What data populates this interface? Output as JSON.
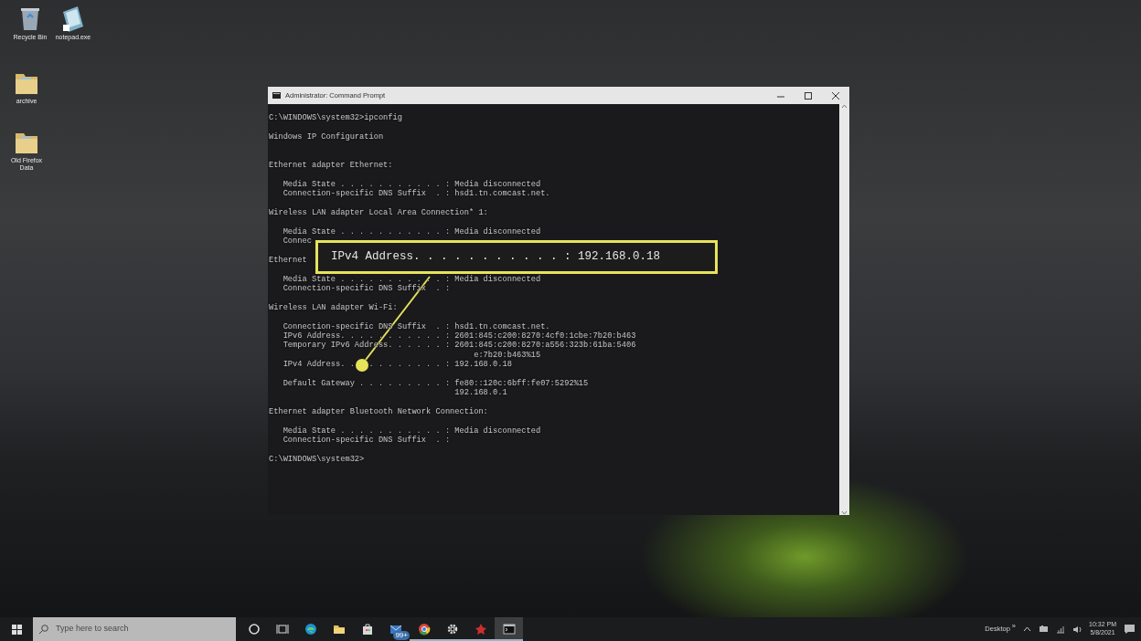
{
  "desktop_icons": [
    {
      "label": "Recycle Bin",
      "kind": "recycle"
    },
    {
      "label": "notepad.exe",
      "kind": "notepad"
    },
    {
      "label": "archive",
      "kind": "folder"
    },
    {
      "label": "Old Firefox Data",
      "kind": "folder"
    }
  ],
  "window": {
    "title": "Administrator: Command Prompt",
    "console_lines": [
      {
        "kind": "text",
        "text": "C:\\WINDOWS\\system32>ipconfig"
      },
      {
        "kind": "blank"
      },
      {
        "kind": "text",
        "text": "Windows IP Configuration"
      },
      {
        "kind": "blank"
      },
      {
        "kind": "blank"
      },
      {
        "kind": "text",
        "text": "Ethernet adapter Ethernet:"
      },
      {
        "kind": "blank"
      },
      {
        "kind": "text",
        "text": "   Media State . . . . . . . . . . . : Media disconnected"
      },
      {
        "kind": "text",
        "text": "   Connection-specific DNS Suffix  . : hsd1.tn.comcast.net."
      },
      {
        "kind": "blank"
      },
      {
        "kind": "text",
        "text": "Wireless LAN adapter Local Area Connection* 1:"
      },
      {
        "kind": "blank"
      },
      {
        "kind": "text",
        "text": "   Media State . . . . . . . . . . . : Media disconnected"
      },
      {
        "kind": "text",
        "text": "   Connec"
      },
      {
        "kind": "blank"
      },
      {
        "kind": "text",
        "text": "Ethernet"
      },
      {
        "kind": "blank"
      },
      {
        "kind": "text",
        "text": "   Media State . . . . . . . . . . . : Media disconnected"
      },
      {
        "kind": "text",
        "text": "   Connection-specific DNS Suffix  . :"
      },
      {
        "kind": "blank"
      },
      {
        "kind": "text",
        "text": "Wireless LAN adapter Wi-Fi:"
      },
      {
        "kind": "blank"
      },
      {
        "kind": "text",
        "text": "   Connection-specific DNS Suffix  . : hsd1.tn.comcast.net."
      },
      {
        "kind": "text",
        "text": "   IPv6 Address. . . . . . . . . . . : 2601:845:c200:8270:4cf0:1cbe:7b20:b463"
      },
      {
        "kind": "text",
        "text": "   Temporary IPv6 Address. . . . . . : 2601:845:c200:8270:a556:323b:61ba:5406"
      },
      {
        "kind": "text",
        "text": "                                           e:7b20:b463%15"
      },
      {
        "kind": "split",
        "parts": [
          "   IPv4 Address. .",
          ". . . . . . . . : 192.168.0.18"
        ]
      },
      {
        "kind": "blank"
      },
      {
        "kind": "text",
        "text": "   Default Gateway . . . . . . . . . : fe80::120c:6bff:fe07:5292%15"
      },
      {
        "kind": "text",
        "text": "                                       192.168.0.1"
      },
      {
        "kind": "blank"
      },
      {
        "kind": "text",
        "text": "Ethernet adapter Bluetooth Network Connection:"
      },
      {
        "kind": "blank"
      },
      {
        "kind": "text",
        "text": "   Media State . . . . . . . . . . . : Media disconnected"
      },
      {
        "kind": "text",
        "text": "   Connection-specific DNS Suffix  . :"
      },
      {
        "kind": "blank"
      },
      {
        "kind": "text",
        "text": "C:\\WINDOWS\\system32>"
      }
    ],
    "callout": {
      "text": "IPv4 Address. . . . . . . . . . . : 192.168.0.18"
    }
  },
  "taskbar": {
    "search": {
      "placeholder": "Type here to search"
    },
    "buttons": [
      {
        "kind": "cortana",
        "running": false,
        "active": false
      },
      {
        "kind": "taskview",
        "running": false,
        "active": false
      },
      {
        "kind": "edge",
        "running": false,
        "active": false
      },
      {
        "kind": "explorer",
        "running": false,
        "active": false
      },
      {
        "kind": "store",
        "running": false,
        "active": false
      },
      {
        "kind": "mail",
        "badge": "99+",
        "running": false,
        "active": false
      },
      {
        "kind": "chrome",
        "running": true,
        "active": false
      },
      {
        "kind": "settings",
        "running": true,
        "active": false
      },
      {
        "kind": "redapp",
        "running": true,
        "active": false
      },
      {
        "kind": "cmd",
        "running": true,
        "active": true
      }
    ],
    "tray": {
      "toolbar_label": "Desktop",
      "toolbar_more": "»",
      "time": "10:32 PM",
      "date": "5/8/2021"
    }
  }
}
